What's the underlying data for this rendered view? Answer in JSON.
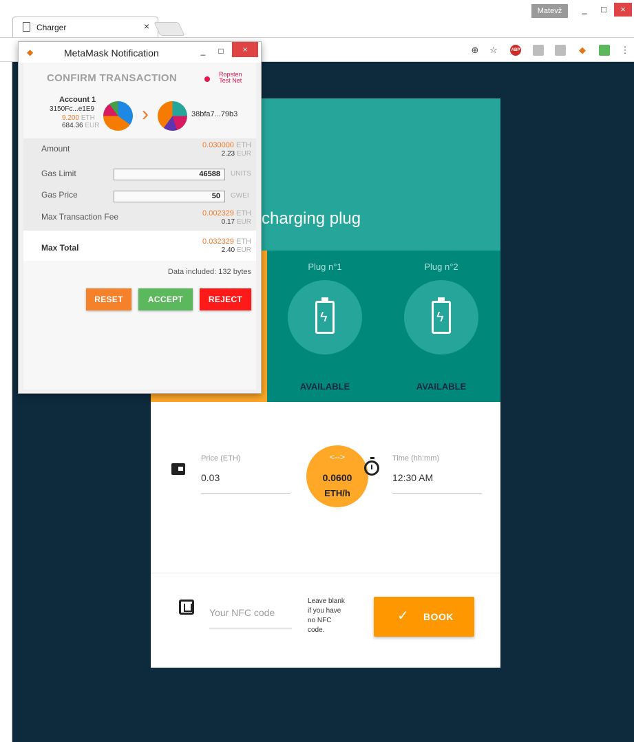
{
  "os": {
    "user": "Matevž",
    "minimize": "_",
    "maximize": "□",
    "close": "×"
  },
  "browser": {
    "tab_title": "Charger",
    "tab_close": "×",
    "toolbar_icons": [
      "zoom-icon",
      "star-icon",
      "adblock-icon",
      "extension-icon",
      "pdf-icon",
      "metamask-icon",
      "printer-icon",
      "menu-icon"
    ],
    "abp_text": "ABP"
  },
  "app": {
    "title": "charging plug",
    "plugs": [
      {
        "label": "Plug n°1",
        "status": "AVAILABLE"
      },
      {
        "label": "Plug n°2",
        "status": "AVAILABLE"
      }
    ],
    "price": {
      "label": "Price (ETH)",
      "value": "0.03"
    },
    "rate": {
      "arrows": "<-->",
      "value": "0.0600",
      "unit": "ETH/h"
    },
    "time": {
      "label": "Time (hh:mm)",
      "value": "12:30 AM"
    },
    "nfc": {
      "placeholder": "Your NFC code",
      "hint": "Leave blank if you have no NFC code."
    },
    "book_label": "BOOK",
    "book_icon": "✓"
  },
  "metamask": {
    "window_title": "MetaMask Notification",
    "heading": "CONFIRM TRANSACTION",
    "network_line1": "Ropsten",
    "network_line2": "Test Net",
    "account": {
      "name": "Account 1",
      "address": "3150Fc...e1E9",
      "eth_value": "9.200",
      "eth_unit": "ETH",
      "eur_value": "684.36",
      "eur_unit": "EUR"
    },
    "chevron": "›",
    "to_address": "38bfa7...79b3",
    "amount": {
      "label": "Amount",
      "eth": "0.030000",
      "eth_unit": "ETH",
      "eur": "2.23",
      "eur_unit": "EUR"
    },
    "gas_limit": {
      "label": "Gas Limit",
      "value": "46588",
      "unit": "UNITS"
    },
    "gas_price": {
      "label": "Gas Price",
      "value": "50",
      "unit": "GWEI"
    },
    "max_fee": {
      "label": "Max Transaction Fee",
      "eth": "0.002329",
      "eth_unit": "ETH",
      "eur": "0.17",
      "eur_unit": "EUR"
    },
    "max_total": {
      "label": "Max Total",
      "eth": "0.032329",
      "eth_unit": "ETH",
      "eur": "2.40",
      "eur_unit": "EUR"
    },
    "data_included": "Data included: 132 bytes",
    "buttons": {
      "reset": "RESET",
      "accept": "ACCEPT",
      "reject": "REJECT"
    },
    "colors": {
      "reset": "#f5812b",
      "accept": "#5cb85c",
      "reject": "#ff1a1a"
    }
  }
}
